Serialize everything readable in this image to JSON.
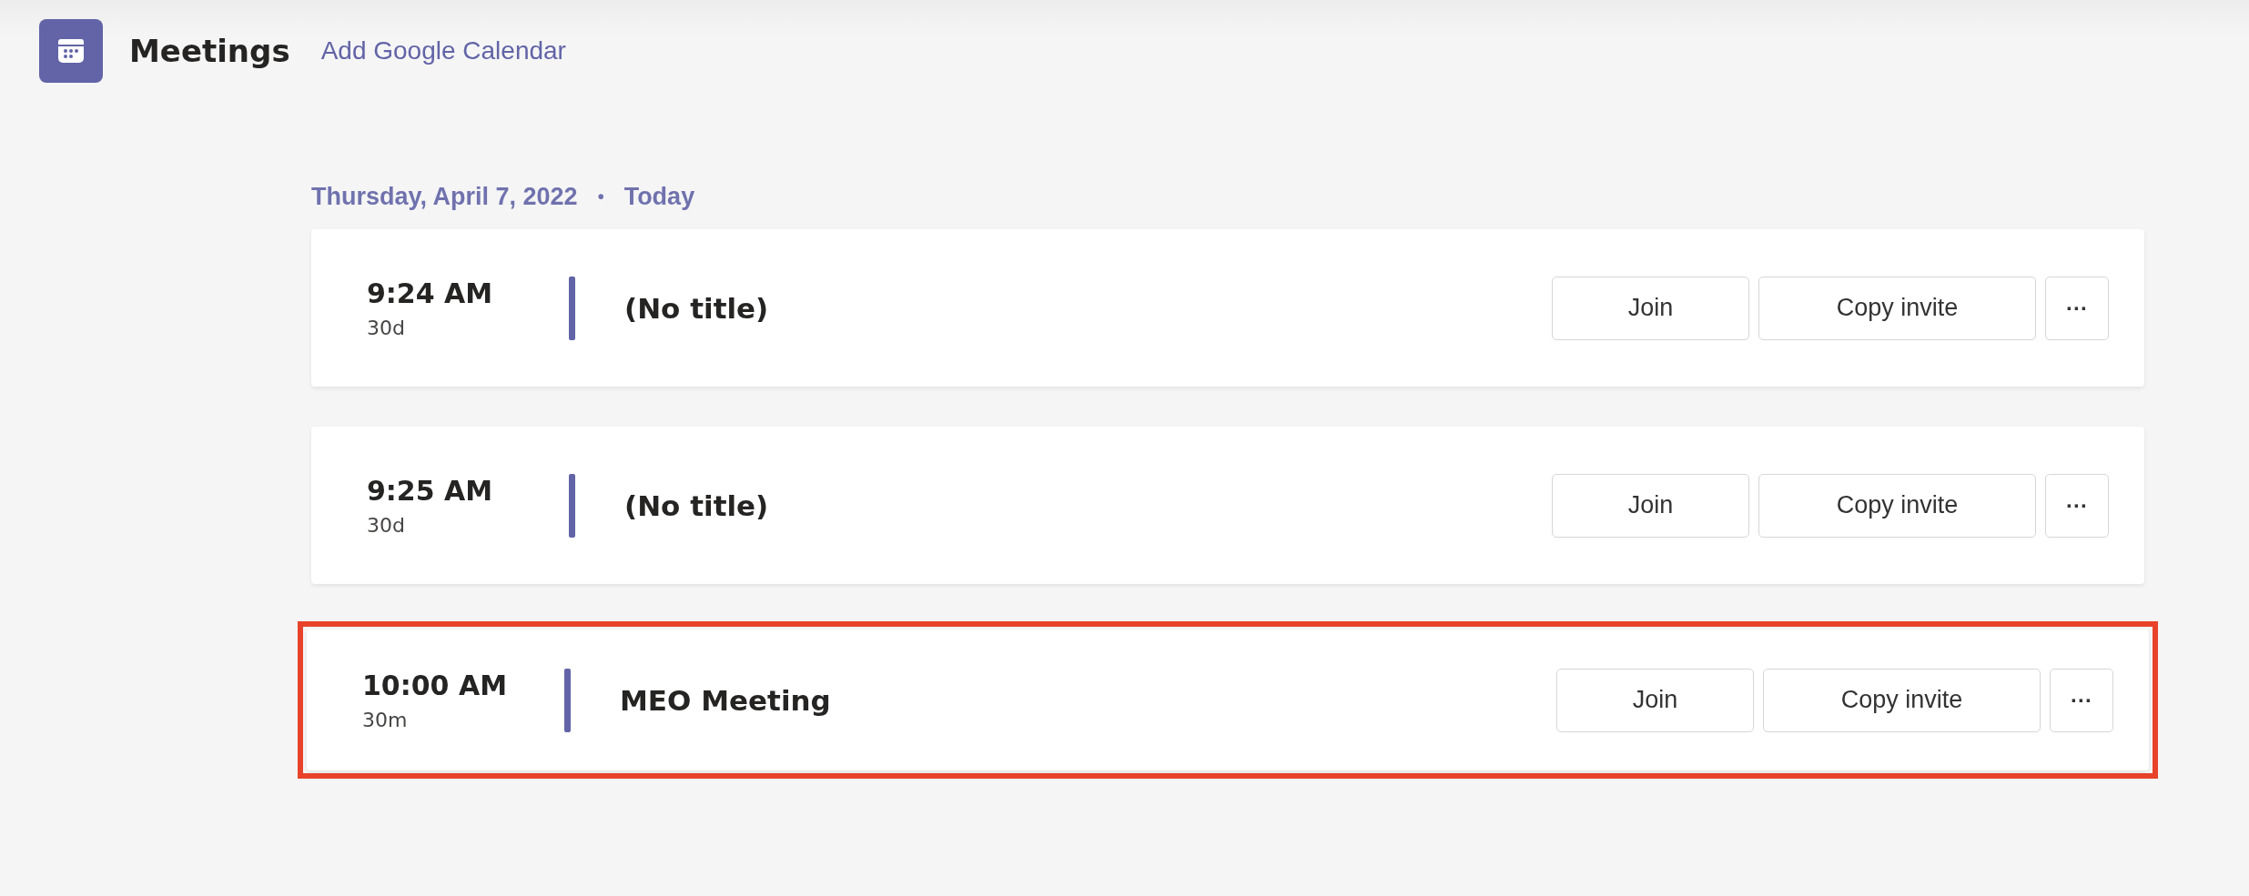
{
  "header": {
    "title": "Meetings",
    "link": "Add Google Calendar"
  },
  "day": {
    "date": "Thursday, April 7, 2022",
    "separator": "•",
    "label": "Today"
  },
  "meetings": [
    {
      "time": "9:24 AM",
      "duration": "30d",
      "title": "(No title)",
      "highlighted": false,
      "buttons": [
        "Join",
        "Copy invite"
      ],
      "more": "···"
    },
    {
      "time": "9:25 AM",
      "duration": "30d",
      "title": "(No title)",
      "highlighted": false,
      "buttons": [
        "Join",
        "Copy invite"
      ],
      "more": "···"
    },
    {
      "time": "10:00 AM",
      "duration": "30m",
      "title": "MEO Meeting",
      "highlighted": true,
      "buttons": [
        "Join",
        "Copy invite"
      ],
      "more": "···"
    }
  ]
}
